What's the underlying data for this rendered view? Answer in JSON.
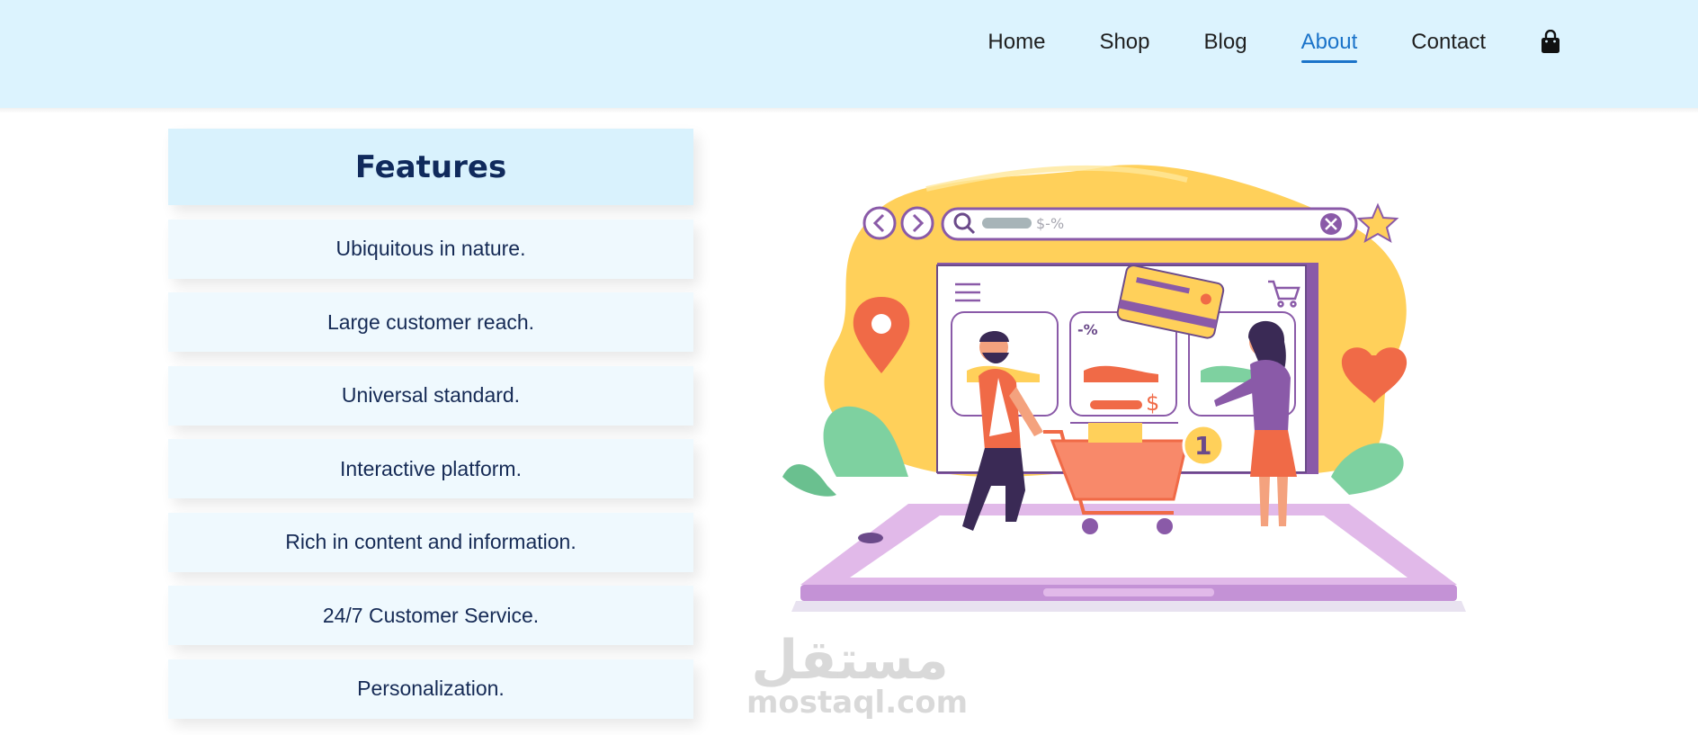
{
  "nav": {
    "items": [
      {
        "label": "Home",
        "active": false
      },
      {
        "label": "Shop",
        "active": false
      },
      {
        "label": "Blog",
        "active": false
      },
      {
        "label": "About",
        "active": true
      },
      {
        "label": "Contact",
        "active": false
      }
    ],
    "cart_icon": "shopping-bag-icon",
    "accent_color": "#1b73c9"
  },
  "features": {
    "title": "Features",
    "items": [
      "Ubiquitous in nature.",
      "Large customer reach.",
      "Universal standard.",
      "Interactive platform.",
      "Rich in content and information.",
      "24/7 Customer Service.",
      "Personalization."
    ]
  },
  "illustration": {
    "search_text": "$-%",
    "discount_text": "-%",
    "price_text": "$",
    "cart_count": "1"
  },
  "watermark": {
    "arabic": "مستقل",
    "latin": "mostaql.com"
  },
  "colors": {
    "header_bg": "#dcf3fe",
    "title_bg": "#d9f2fd",
    "item_bg": "#eff9fe",
    "text_dark": "#152a55"
  }
}
